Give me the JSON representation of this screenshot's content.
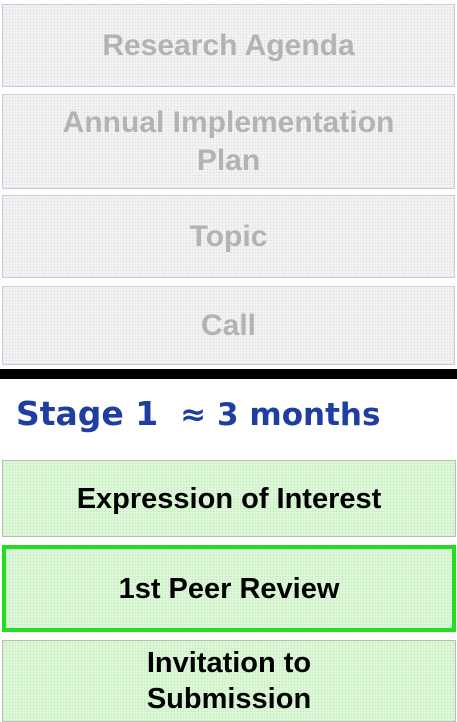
{
  "preliminary_steps": [
    {
      "label": "Research Agenda"
    },
    {
      "label": "Annual Implementation Plan"
    },
    {
      "label": "Topic"
    },
    {
      "label": "Call"
    }
  ],
  "stage": {
    "label": "Stage 1",
    "duration": "≈ 3 months"
  },
  "stage_steps": [
    {
      "label": "Expression of Interest"
    },
    {
      "label": "1st Peer Review",
      "highlighted": true
    },
    {
      "label": "Invitation to Submission"
    }
  ],
  "colors": {
    "faded_text": "#b3b3b3",
    "stage_text": "#1e3ea0",
    "step_fill": "#ddf9d8",
    "highlight_border": "#22dd22"
  }
}
